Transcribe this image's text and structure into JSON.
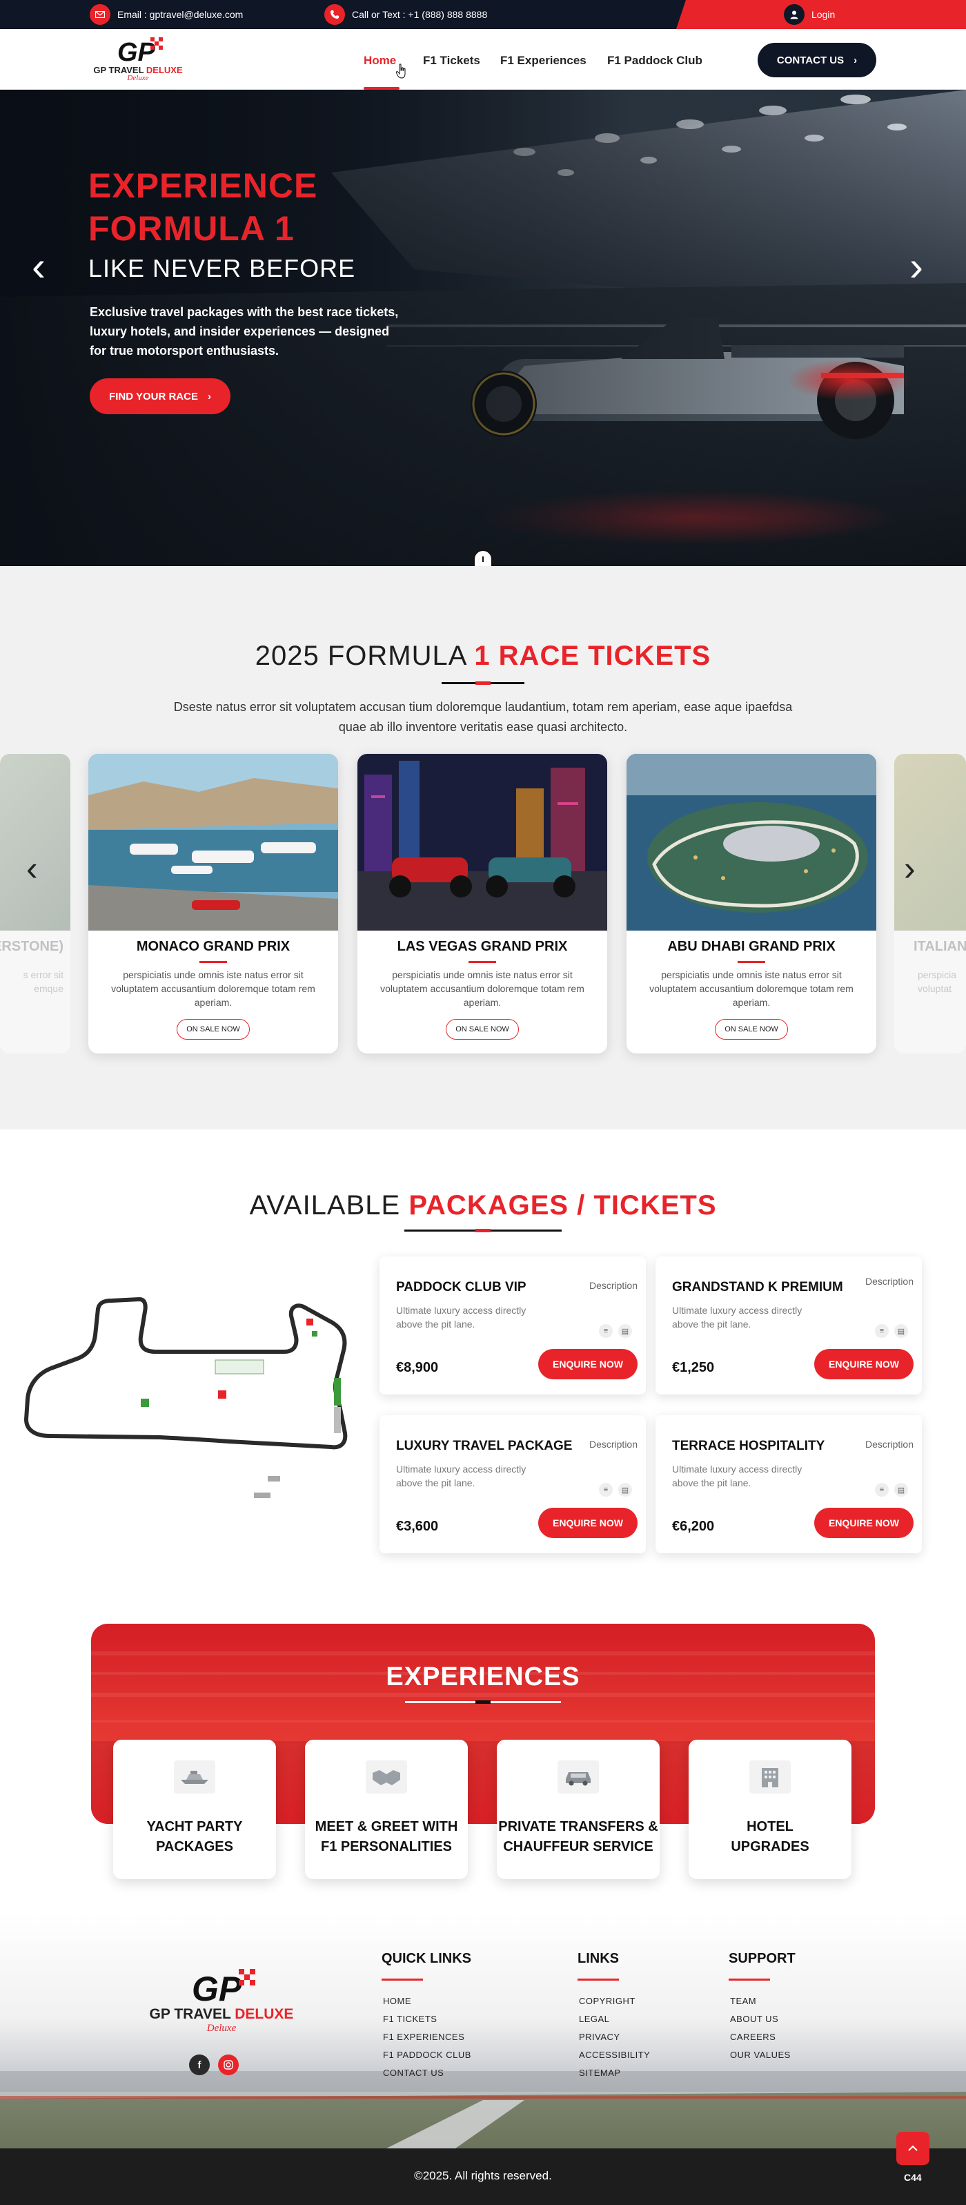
{
  "topbar": {
    "email": "Email : gptravel@deluxe.com",
    "phone": "Call or Text : +1 (888) 888 8888",
    "login": "Login"
  },
  "brand": {
    "mark": "GP",
    "name_black": "GP TRAVEL ",
    "name_red": "DELUXE",
    "script": "Deluxe"
  },
  "nav": {
    "links": [
      "Home",
      "F1 Tickets",
      "F1 Experiences",
      "F1 Paddock Club"
    ],
    "contact": "CONTACT US"
  },
  "hero": {
    "title_line1": "EXPERIENCE",
    "title_line2": "FORMULA 1",
    "subtitle": "LIKE NEVER BEFORE",
    "description": "Exclusive travel packages with the best race tickets, luxury hotels, and insider experiences — designed for true motorsport enthusiasts.",
    "cta": "FIND YOUR RACE"
  },
  "tickets": {
    "title_dark": "2025 FORMULA ",
    "title_red": "1 RACE TICKETS",
    "description": "Dseste natus error sit voluptatem accusan tium doloremque laudantium, totam rem aperiam, ease aque ipaefdsa quae ab illo inventore veritatis ease quasi architecto.",
    "ghost_left_name": "ERSTONE)",
    "ghost_left_desc": "s error sit\nemque",
    "ghost_right_name": "ITALIAN",
    "ghost_right_desc": "perspicia\nvoluptat",
    "cards": [
      {
        "name": "MONACO GRAND PRIX",
        "desc": "perspiciatis unde omnis iste natus error sit voluptatem accusantium doloremque totam rem aperiam.",
        "button": "ON SALE NOW"
      },
      {
        "name": "LAS VEGAS GRAND PRIX",
        "desc": "perspiciatis unde omnis iste natus error sit voluptatem accusantium doloremque totam rem aperiam.",
        "button": "ON SALE NOW"
      },
      {
        "name": "ABU DHABI GRAND PRIX",
        "desc": "perspiciatis unde omnis iste natus error sit voluptatem accusantium doloremque totam rem aperiam.",
        "button": "ON SALE NOW"
      }
    ]
  },
  "packages": {
    "title_dark": "AVAILABLE ",
    "title_red": "PACKAGES / TICKETS",
    "items": [
      {
        "name": "PADDOCK CLUB VIP",
        "link": "Description",
        "text": "Ultimate luxury access directly above the pit lane.",
        "price": "€8,900",
        "button": "ENQUIRE NOW"
      },
      {
        "name": "GRANDSTAND K PREMIUM",
        "link": "Description",
        "text": "Ultimate luxury access directly above the pit lane.",
        "price": "€1,250",
        "button": "ENQUIRE NOW"
      },
      {
        "name": "LUXURY TRAVEL PACKAGE",
        "link": "Description",
        "text": "Ultimate luxury access directly above the pit lane.",
        "price": "€3,600",
        "button": "ENQUIRE NOW"
      },
      {
        "name": "TERRACE HOSPITALITY",
        "link": "Description",
        "text": "Ultimate luxury access directly above the pit lane.",
        "price": "€6,200",
        "button": "ENQUIRE NOW"
      }
    ]
  },
  "experiences": {
    "title": "EXPERIENCES",
    "items": [
      {
        "name": "YACHT PARTY\nPACKAGES",
        "icon": "yacht-icon"
      },
      {
        "name": "MEET & GREET WITH\nF1 PERSONALITIES",
        "icon": "handshake-icon"
      },
      {
        "name": "PRIVATE TRANSFERS &\nCHAUFFEUR SERVICE",
        "icon": "car-icon"
      },
      {
        "name": "HOTEL\nUPGRADES",
        "icon": "hotel-icon"
      }
    ]
  },
  "footer": {
    "quick_links_title": "QUICK LINKS",
    "quick_links": [
      "HOME",
      "F1 TICKETS",
      "F1 EXPERIENCES",
      "F1 PADDOCK CLUB",
      "CONTACT US"
    ],
    "links_title": "LINKS",
    "links": [
      "COPYRIGHT",
      "LEGAL",
      "PRIVACY",
      "ACCESSIBILITY",
      "SITEMAP"
    ],
    "support_title": "SUPPORT",
    "support": [
      "TEAM",
      "ABOUT US",
      "CAREERS",
      "OUR VALUES"
    ],
    "copyright": "©2025. All rights reserved.",
    "badge": "C44"
  },
  "colors": {
    "accent": "#e8242a",
    "dark": "#0f1626"
  }
}
